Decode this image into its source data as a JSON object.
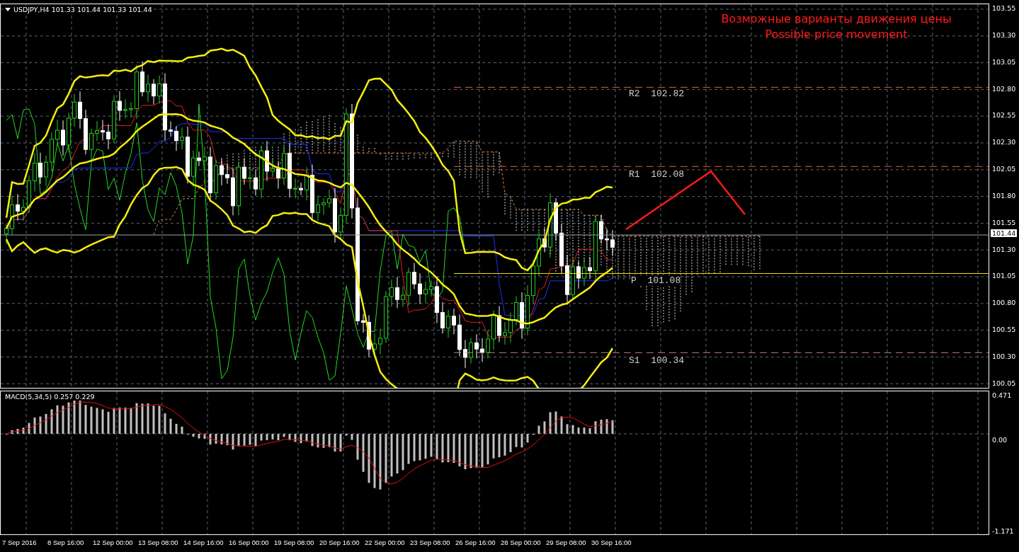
{
  "chart": {
    "symbol_label": "USDJPY,H4  101.33 101.44 101.33 101.44",
    "annotation": [
      "Возможные варианты движения цены",
      "Possible price movement"
    ],
    "levels": [
      {
        "label": "R2  102.82"
      },
      {
        "label": "R1  102.08"
      },
      {
        "label": "P  101.08"
      },
      {
        "label": "S1  100.34"
      }
    ],
    "price_axis": [
      "103.55",
      "103.30",
      "103.05",
      "102.80",
      "102.55",
      "102.30",
      "102.05",
      "101.80",
      "101.55",
      "101.30",
      "101.05",
      "100.80",
      "100.55",
      "100.30",
      "100.05"
    ],
    "current_price": "101.44"
  },
  "macd": {
    "label": "MACD(5,34,5) 0.257 0.229",
    "axis": [
      "0.471",
      "0.00",
      "-1.171"
    ]
  },
  "time_axis": [
    "7 Sep 2016",
    "8 Sep 16:00",
    "12 Sep 00:00",
    "13 Sep 08:00",
    "14 Sep 16:00",
    "16 Sep 00:00",
    "19 Sep 08:00",
    "20 Sep 16:00",
    "22 Sep 00:00",
    "23 Sep 08:00",
    "26 Sep 16:00",
    "28 Sep 00:00",
    "29 Sep 08:00",
    "30 Sep 16:00"
  ]
}
